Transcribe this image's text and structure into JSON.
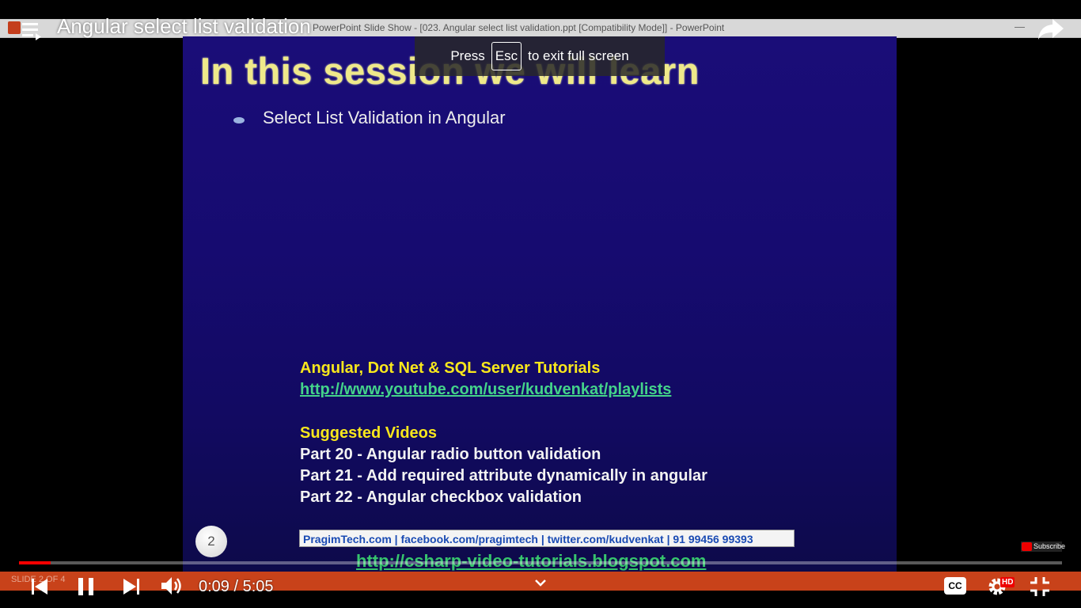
{
  "powerpoint": {
    "window_title": "PowerPoint Slide Show - [023. Angular select list validation.ppt [Compatibility Mode]] - PowerPoint",
    "status_text": "SLIDE 2 OF 4"
  },
  "slide": {
    "title": "In this session we will learn",
    "bullet": "Select List Validation in Angular",
    "tutorials_heading": "Angular, Dot Net & SQL Server Tutorials",
    "tutorials_link": "http://www.youtube.com/user/kudvenkat/playlists",
    "suggested_heading": "Suggested Videos",
    "suggested_items": [
      "Part 20 - Angular radio button validation",
      "Part 21 - Add required attribute dynamically in angular",
      "Part 22 - Angular checkbox validation"
    ],
    "slide_number": "2",
    "footer_banner": "PragimTech.com | facebook.com/pragimtech | twitter.com/kudvenkat | 91 99456 99393",
    "blog_link": "http://csharp-video-tutorials.blogspot.com"
  },
  "player": {
    "video_title": "Angular select list validation",
    "toast_press": "Press",
    "toast_key": "Esc",
    "toast_rest": "to exit full screen",
    "current_time": "0:09",
    "duration": "5:05",
    "time_display": "0:09 / 5:05",
    "progress_fraction": 0.03,
    "subscribe_label": "Subscribe",
    "cc_label": "CC",
    "hd_label": "HD",
    "accent_color": "#ff0000"
  },
  "icons": [
    "playlist-icon",
    "share-icon",
    "previous-icon",
    "pause-icon",
    "next-icon",
    "volume-icon",
    "chevron-down-icon",
    "captions-icon",
    "settings-icon",
    "exit-fullscreen-icon"
  ]
}
